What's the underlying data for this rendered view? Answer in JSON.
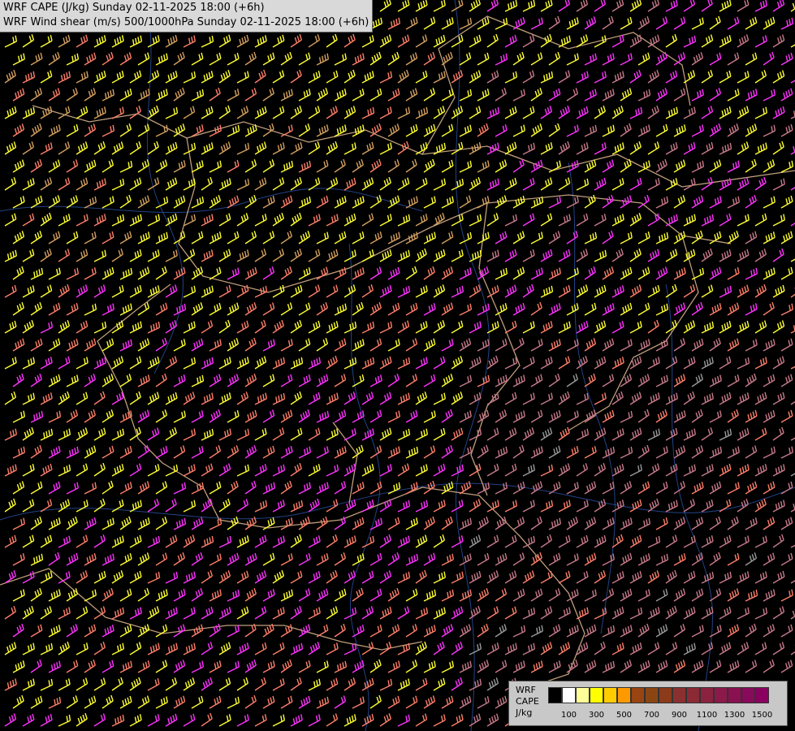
{
  "header": {
    "line1": "WRF CAPE (J/kg) Sunday 02-11-2025 18:00 (+6h)",
    "line2": "WRF Wind shear (m/s) 500/1000hPa Sunday 02-11-2025 18:00 (+6h)"
  },
  "legend": {
    "line1": "WRF",
    "line2": "CAPE",
    "line3": "J/kg",
    "ticks": [
      "100",
      "300",
      "500",
      "700",
      "900",
      "1100",
      "1300",
      "1500"
    ],
    "colors": [
      "#000000",
      "#ffffff",
      "#ffff99",
      "#ffff00",
      "#ffcc00",
      "#ff9900",
      "#994411",
      "#8b4513",
      "#8b3a1a",
      "#8b3030",
      "#8b2a35",
      "#8b2340",
      "#8b1a4a",
      "#8b1050",
      "#880a5a",
      "#8a005f"
    ]
  },
  "barb_colors": {
    "yellow": "#ffff33",
    "tan": "#d4a060",
    "salmon": "#ff7f6a",
    "magenta": "#ff33ff",
    "mauve": "#c87a8a",
    "gray": "#9a9a9a",
    "border": "#e0b890",
    "river": "#3060c0"
  }
}
